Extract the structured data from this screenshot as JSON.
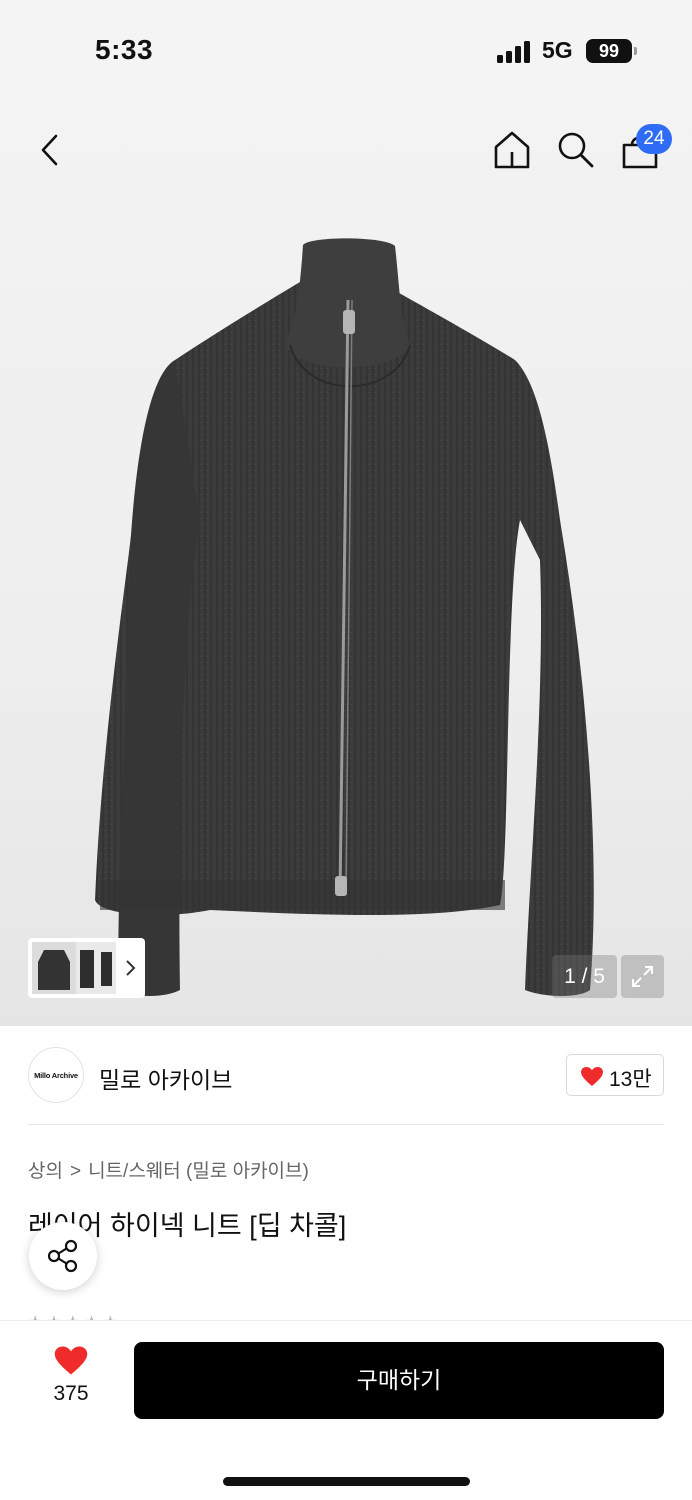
{
  "status_bar": {
    "time": "5:33",
    "network": "5G",
    "battery": "99"
  },
  "header": {
    "cart_count": "24"
  },
  "gallery": {
    "counter": "1 / 5",
    "image_description_icon": "knit-zip-cardigan-image"
  },
  "brand": {
    "logo_text": "Millo Archive",
    "name": "밀로 아카이브",
    "likes": "13만"
  },
  "breadcrumb": {
    "category": "상의",
    "subcategory": "니트/스웨터 (밀로 아카이브)"
  },
  "product": {
    "title": "레이어 하이넥 니트 [딥 차콜]"
  },
  "bottom_bar": {
    "wish_count": "375",
    "buy_label": "구매하기"
  },
  "colors": {
    "heart": "#f02b2b",
    "badge": "#2f6cf6",
    "buy_button": "#000000"
  }
}
